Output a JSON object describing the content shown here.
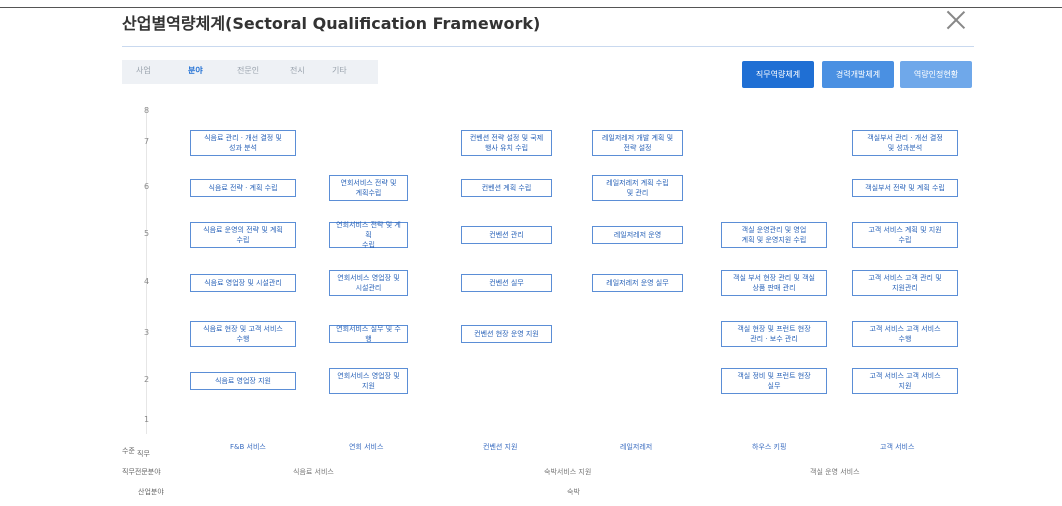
{
  "title": "산업별역량체계(Sectoral Qualification Framework)",
  "tabs": [
    {
      "label": "사업",
      "active": false
    },
    {
      "label": "분야",
      "active": true
    },
    {
      "label": "전문인",
      "active": false
    },
    {
      "label": "전시",
      "active": false
    },
    {
      "label": "기타",
      "active": false
    }
  ],
  "buttons": [
    {
      "label": "직무역량체계",
      "color": "#1f6fd4"
    },
    {
      "label": "경력개발체계",
      "color": "#4a90e2"
    },
    {
      "label": "역량인정현황",
      "color": "#6fa8ea"
    }
  ],
  "levels": [
    "8",
    "7",
    "6",
    "5",
    "4",
    "3",
    "2",
    "1"
  ],
  "boxes": [
    {
      "id": "b1",
      "lvl": "7",
      "col": 0,
      "lines": [
        "식음료 관리 · 개선 결정 및",
        "성과 분석"
      ]
    },
    {
      "id": "b2",
      "lvl": "7",
      "col": 2,
      "lines": [
        "컨벤션 전략 설정 및 국제",
        "행사 유치 수립"
      ]
    },
    {
      "id": "b3",
      "lvl": "7",
      "col": 3,
      "lines": [
        "레일저레저 개발 계획 및",
        "전략 설정"
      ]
    },
    {
      "id": "b4",
      "lvl": "7",
      "col": 5,
      "lines": [
        "객실부서 관리 · 개선 결정",
        "및 성과분석"
      ]
    },
    {
      "id": "b5",
      "lvl": "6",
      "col": 0,
      "lines": [
        "식음료 전략 · 계획 수립"
      ]
    },
    {
      "id": "b6",
      "lvl": "6",
      "col": 1,
      "lines": [
        "연회서비스 전략 및",
        "계획수립"
      ]
    },
    {
      "id": "b7",
      "lvl": "6",
      "col": 2,
      "lines": [
        "컨벤션 계획 수립"
      ]
    },
    {
      "id": "b8",
      "lvl": "6",
      "col": 3,
      "lines": [
        "레일저레저 계획 수립",
        "및 관리"
      ]
    },
    {
      "id": "b9",
      "lvl": "6",
      "col": 5,
      "lines": [
        "객실부서 전략 및 계획 수립"
      ]
    },
    {
      "id": "b10",
      "lvl": "5",
      "col": 0,
      "lines": [
        "식음료 운영의 전략 및 계획",
        "수립"
      ]
    },
    {
      "id": "b11",
      "lvl": "5",
      "col": 1,
      "lines": [
        "연회서비스 전략 및 계획",
        "수립"
      ]
    },
    {
      "id": "b12",
      "lvl": "5",
      "col": 2,
      "lines": [
        "컨벤션 관리"
      ]
    },
    {
      "id": "b13",
      "lvl": "5",
      "col": 3,
      "lines": [
        "레일저레저 운영"
      ]
    },
    {
      "id": "b14",
      "lvl": "5",
      "col": 4,
      "lines": [
        "객실 운영관리 및 영업",
        "계획 및 운영지원 수립"
      ]
    },
    {
      "id": "b15",
      "lvl": "5",
      "col": 5,
      "lines": [
        "고객 서비스 계획 및 지원",
        "수립"
      ]
    },
    {
      "id": "b16",
      "lvl": "4",
      "col": 0,
      "lines": [
        "식음료 영업장 및 시설관리"
      ]
    },
    {
      "id": "b17",
      "lvl": "4",
      "col": 1,
      "lines": [
        "연회서비스 영업장 및",
        "시설관리"
      ]
    },
    {
      "id": "b18",
      "lvl": "4",
      "col": 2,
      "lines": [
        "컨벤션 실무"
      ]
    },
    {
      "id": "b19",
      "lvl": "4",
      "col": 3,
      "lines": [
        "레일저레저 운영 실무"
      ]
    },
    {
      "id": "b20",
      "lvl": "4",
      "col": 4,
      "lines": [
        "객실 부서 현장 관리 및 객실",
        "상품 판매 관리"
      ]
    },
    {
      "id": "b21",
      "lvl": "4",
      "col": 5,
      "lines": [
        "고객 서비스 고객 관리 및",
        "지원관리"
      ]
    },
    {
      "id": "b22",
      "lvl": "3",
      "col": 0,
      "lines": [
        "식음료 현장 및 고객 서비스",
        "수행"
      ]
    },
    {
      "id": "b23",
      "lvl": "3",
      "col": 1,
      "lines": [
        "연회서비스 실무 및 수행"
      ]
    },
    {
      "id": "b24",
      "lvl": "3",
      "col": 2,
      "lines": [
        "컨벤션 현장 운영 지원"
      ]
    },
    {
      "id": "b25",
      "lvl": "3",
      "col": 4,
      "lines": [
        "객실 현장 및 프런트 현장",
        "관리 · 보수 관리"
      ]
    },
    {
      "id": "b26",
      "lvl": "3",
      "col": 5,
      "lines": [
        "고객 서비스 고객 서비스",
        "수행"
      ]
    },
    {
      "id": "b27",
      "lvl": "2",
      "col": 0,
      "lines": [
        "식음료 영업장 지원"
      ]
    },
    {
      "id": "b28",
      "lvl": "2",
      "col": 1,
      "lines": [
        "연회서비스 영업장 및",
        "지원"
      ]
    },
    {
      "id": "b29",
      "lvl": "2",
      "col": 4,
      "lines": [
        "객실 정비 및 프런트 현장",
        "실무"
      ]
    },
    {
      "id": "b30",
      "lvl": "2",
      "col": 5,
      "lines": [
        "고객 서비스 고객 서비스",
        "지원"
      ]
    }
  ],
  "axis_labels": {
    "corner": "수준",
    "col_header": "직무"
  },
  "categories": [
    "F&B 서비스",
    "연회 서비스",
    "컨벤션 지원",
    "레일저레저",
    "하우스 키핑",
    "고객 서비스"
  ],
  "row_labels": {
    "row2": "직무전문분야",
    "row3": "산업분야"
  },
  "row2_items": [
    "식음료 서비스",
    "숙박서비스 지원",
    "객실 운영 서비스"
  ],
  "row3_item": "숙박"
}
